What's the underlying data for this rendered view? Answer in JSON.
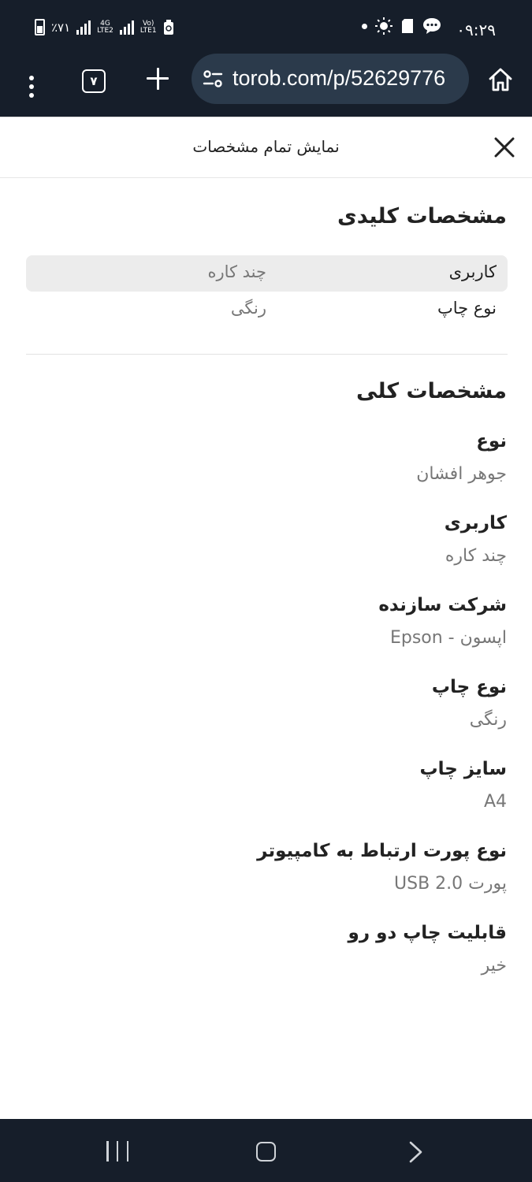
{
  "status_bar": {
    "time": "۰۹:۲۹",
    "battery_percent": "٪۷۱",
    "network_1": "4G",
    "network_2": "LTE2",
    "network_3": "LTE1"
  },
  "browser": {
    "tab_count": "۷",
    "url": "torob.com/p/52629776"
  },
  "sheet": {
    "title": "نمایش تمام مشخصات",
    "key_specs": {
      "title": "مشخصات کلیدی",
      "rows": [
        {
          "label": "کاربری",
          "value": "چند کاره"
        },
        {
          "label": "نوع چاپ",
          "value": "رنگی"
        }
      ]
    },
    "general_specs": {
      "title": "مشخصات کلی",
      "items": [
        {
          "label": "نوع",
          "value": "جوهر افشان"
        },
        {
          "label": "کاربری",
          "value": "چند کاره"
        },
        {
          "label": "شرکت سازنده",
          "value": "اپسون - Epson"
        },
        {
          "label": "نوع چاپ",
          "value": "رنگی"
        },
        {
          "label": "سایز چاپ",
          "value": "A4"
        },
        {
          "label": "نوع پورت ارتباط به کامپیوتر",
          "value": "پورت USB 2.0"
        },
        {
          "label": "قابلیت چاپ دو رو",
          "value": "خیر"
        }
      ]
    }
  }
}
